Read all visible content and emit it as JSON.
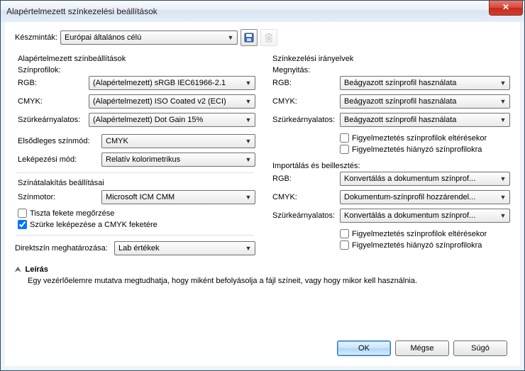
{
  "window": {
    "title": "Alapértelmezett színkezelési beállítások"
  },
  "presets": {
    "label": "Készminták:",
    "value": "Európai általános célú"
  },
  "left": {
    "group1_title": "Alapértelmezett színbeállítások",
    "profiles_label": "Színprofilok:",
    "rgb_label": "RGB:",
    "rgb_value": "(Alapértelmezett) sRGB IEC61966-2.1",
    "cmyk_label": "CMYK:",
    "cmyk_value": "(Alapértelmezett) ISO Coated v2 (ECI)",
    "gray_label": "Szürkeárnyalatos:",
    "gray_value": "(Alapértelmezett) Dot Gain 15%",
    "primary_mode_label": "Elsődleges színmód:",
    "primary_mode_value": "CMYK",
    "rendering_label": "Leképezési mód:",
    "rendering_value": "Relatív kolorimetrikus",
    "group2_title": "Színátalakítás beállításai",
    "engine_label": "Színmotor:",
    "engine_value": "Microsoft ICM CMM",
    "preserve_black_label": "Tiszta fekete megőrzése",
    "preserve_black_checked": false,
    "map_gray_label": "Szürke leképezése a CMYK feketére",
    "map_gray_checked": true,
    "spot_label": "Direktszín meghatározása:",
    "spot_value": "Lab értékek"
  },
  "right": {
    "group_title": "Színkezelési irányelvek",
    "open_label": "Megnyitás:",
    "open_rgb_label": "RGB:",
    "open_rgb_value": "Beágyazott színprofil használata",
    "open_cmyk_label": "CMYK:",
    "open_cmyk_value": "Beágyazott színprofil használata",
    "open_gray_label": "Szürkeárnyalatos:",
    "open_gray_value": "Beágyazott színprofil használata",
    "warn_mismatch_label": "Figyelmeztetés színprofilok eltérésekor",
    "warn_missing_label": "Figyelmeztetés hiányzó színprofilokra",
    "import_label": "Importálás és beillesztés:",
    "imp_rgb_label": "RGB:",
    "imp_rgb_value": "Konvertálás a dokumentum színprof...",
    "imp_cmyk_label": "CMYK:",
    "imp_cmyk_value": "Dokumentum-színprofil hozzárendel...",
    "imp_gray_label": "Szürkeárnyalatos:",
    "imp_gray_value": "Konvertálás a dokumentum színprof..."
  },
  "desc": {
    "title": "Leírás",
    "text": "Egy vezérlőelemre mutatva megtudhatja, hogy miként befolyásolja a fájl színeit, vagy hogy mikor kell használnia."
  },
  "buttons": {
    "ok": "OK",
    "cancel": "Mégse",
    "help": "Súgó"
  }
}
